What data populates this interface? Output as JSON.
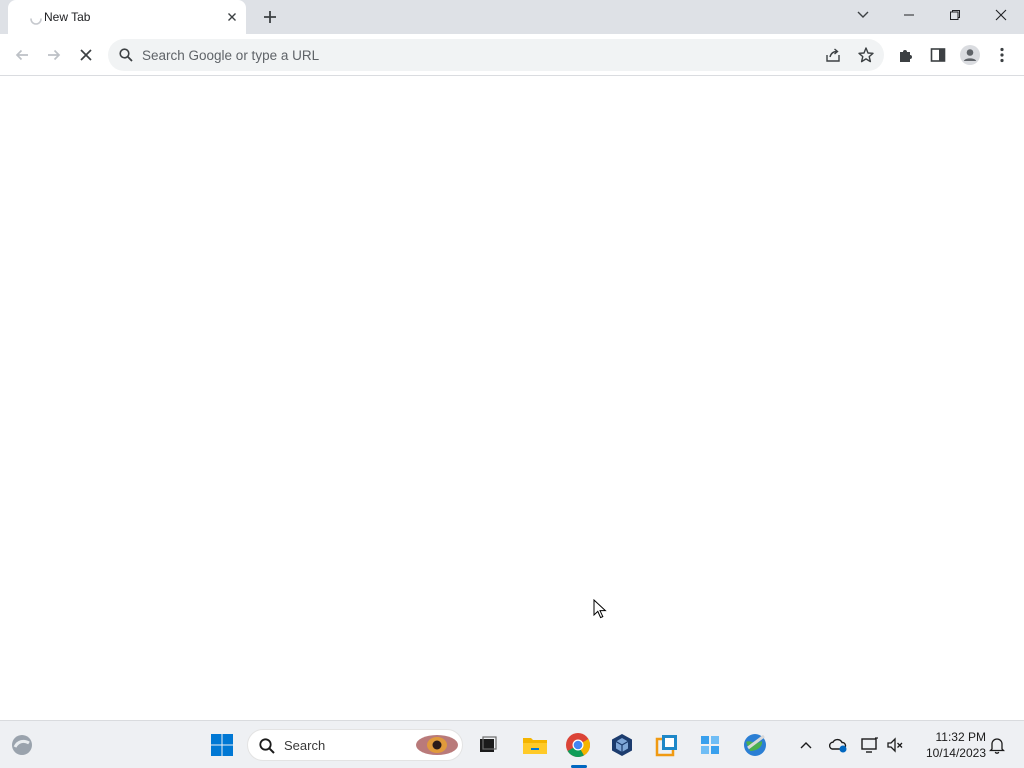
{
  "browser": {
    "tab": {
      "title": "New Tab",
      "state": "loading"
    },
    "toolbar": {
      "omnibox_placeholder": "Search Google or type a URL",
      "buttons": [
        "back",
        "forward",
        "stop",
        "share",
        "bookmark-star",
        "extensions",
        "side-panel",
        "profile",
        "menu"
      ]
    },
    "window_controls": [
      "tab-search",
      "minimize",
      "restore",
      "close"
    ]
  },
  "taskbar": {
    "search_label": "Search",
    "pinned": [
      "widgets",
      "start",
      "search",
      "task-view",
      "file-explorer",
      "chrome",
      "virtualbox",
      "app-orange",
      "app-blue-tiles",
      "app-globe"
    ],
    "active_app": "chrome",
    "tray": {
      "clock_time": "11:32 PM",
      "clock_date": "10/14/2023"
    }
  },
  "colors": {
    "tabstrip": "#dee1e6",
    "omnibox": "#f1f3f4",
    "taskbar": "#eef0f3",
    "accent": "#0067c0"
  }
}
